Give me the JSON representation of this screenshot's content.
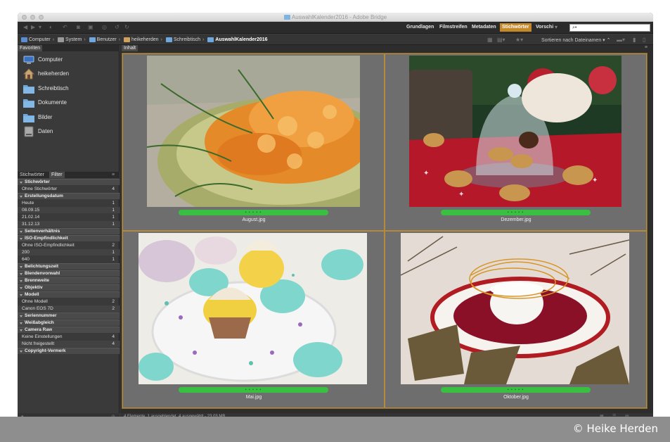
{
  "window": {
    "title": "AuswahlKalender2016 - Adobe Bridge"
  },
  "workspaces": [
    {
      "label": "Grundlagen",
      "active": false
    },
    {
      "label": "Filmstreifen",
      "active": false
    },
    {
      "label": "Metadaten",
      "active": false
    },
    {
      "label": "Stichwörter",
      "active": true
    },
    {
      "label": "Vorschi",
      "active": false
    }
  ],
  "search": {
    "placeholder": "⌕•"
  },
  "breadcrumbs": [
    "Computer",
    "System",
    "Benutzer",
    "heikeherden",
    "Schreibtisch",
    "AuswahlKalender2016"
  ],
  "sort_label": "Sortieren nach Dateinamen",
  "favorites_tab": "Favoriten",
  "favorites": [
    "Computer",
    "heikeherden",
    "Schreibtisch",
    "Dokumente",
    "Bilder",
    "Daten"
  ],
  "keywords_tab": "Stichwörter",
  "filter_tab": "Filter",
  "filter": [
    {
      "type": "h",
      "label": "Stichwörter"
    },
    {
      "type": "r",
      "label": "Ohne Stichwörter",
      "count": "4"
    },
    {
      "type": "h",
      "label": "Erstellungsdatum"
    },
    {
      "type": "r",
      "label": "Heute",
      "count": "1"
    },
    {
      "type": "r",
      "label": "08.09.15",
      "count": "1"
    },
    {
      "type": "r",
      "label": "21.02.14",
      "count": "1"
    },
    {
      "type": "r",
      "label": "31.12.13",
      "count": "1"
    },
    {
      "type": "h",
      "label": "Seitenverhältnis"
    },
    {
      "type": "h",
      "label": "ISO-Empfindlichkeit"
    },
    {
      "type": "r",
      "label": "Ohne ISO-Empfindlichkeit",
      "count": "2"
    },
    {
      "type": "r",
      "label": "200",
      "count": "1"
    },
    {
      "type": "r",
      "label": "640",
      "count": "1"
    },
    {
      "type": "h",
      "label": "Belichtungszeit"
    },
    {
      "type": "h",
      "label": "Blendenvorwahl"
    },
    {
      "type": "h",
      "label": "Brennweite"
    },
    {
      "type": "h",
      "label": "Objektiv"
    },
    {
      "type": "h",
      "label": "Modell"
    },
    {
      "type": "r",
      "label": "Ohne Modell",
      "count": "2"
    },
    {
      "type": "r",
      "label": "Canon EOS 7D",
      "count": "2"
    },
    {
      "type": "h",
      "label": "Seriennummer"
    },
    {
      "type": "h",
      "label": "Weißabgleich"
    },
    {
      "type": "h",
      "label": "Camera Raw"
    },
    {
      "type": "r",
      "label": "Keine Einstellungen",
      "count": "4"
    },
    {
      "type": "r",
      "label": "Nicht freigestellt",
      "count": "4"
    },
    {
      "type": "h",
      "label": "Copyright-Vermerk"
    }
  ],
  "content_tab": "Inhalt",
  "thumbnails": [
    {
      "name": "August.jpg",
      "rating": "• • • • •"
    },
    {
      "name": "Dezember.jpg",
      "rating": "• • • • •"
    },
    {
      "name": "Mai.jpg",
      "rating": "• • • • •"
    },
    {
      "name": "Oktober.jpg",
      "rating": "• • • • •"
    }
  ],
  "status": "4 Elemente, 1 ausgeblendet, 4 ausgewählt - 23,03 MB",
  "copyright": "© Heike Herden"
}
